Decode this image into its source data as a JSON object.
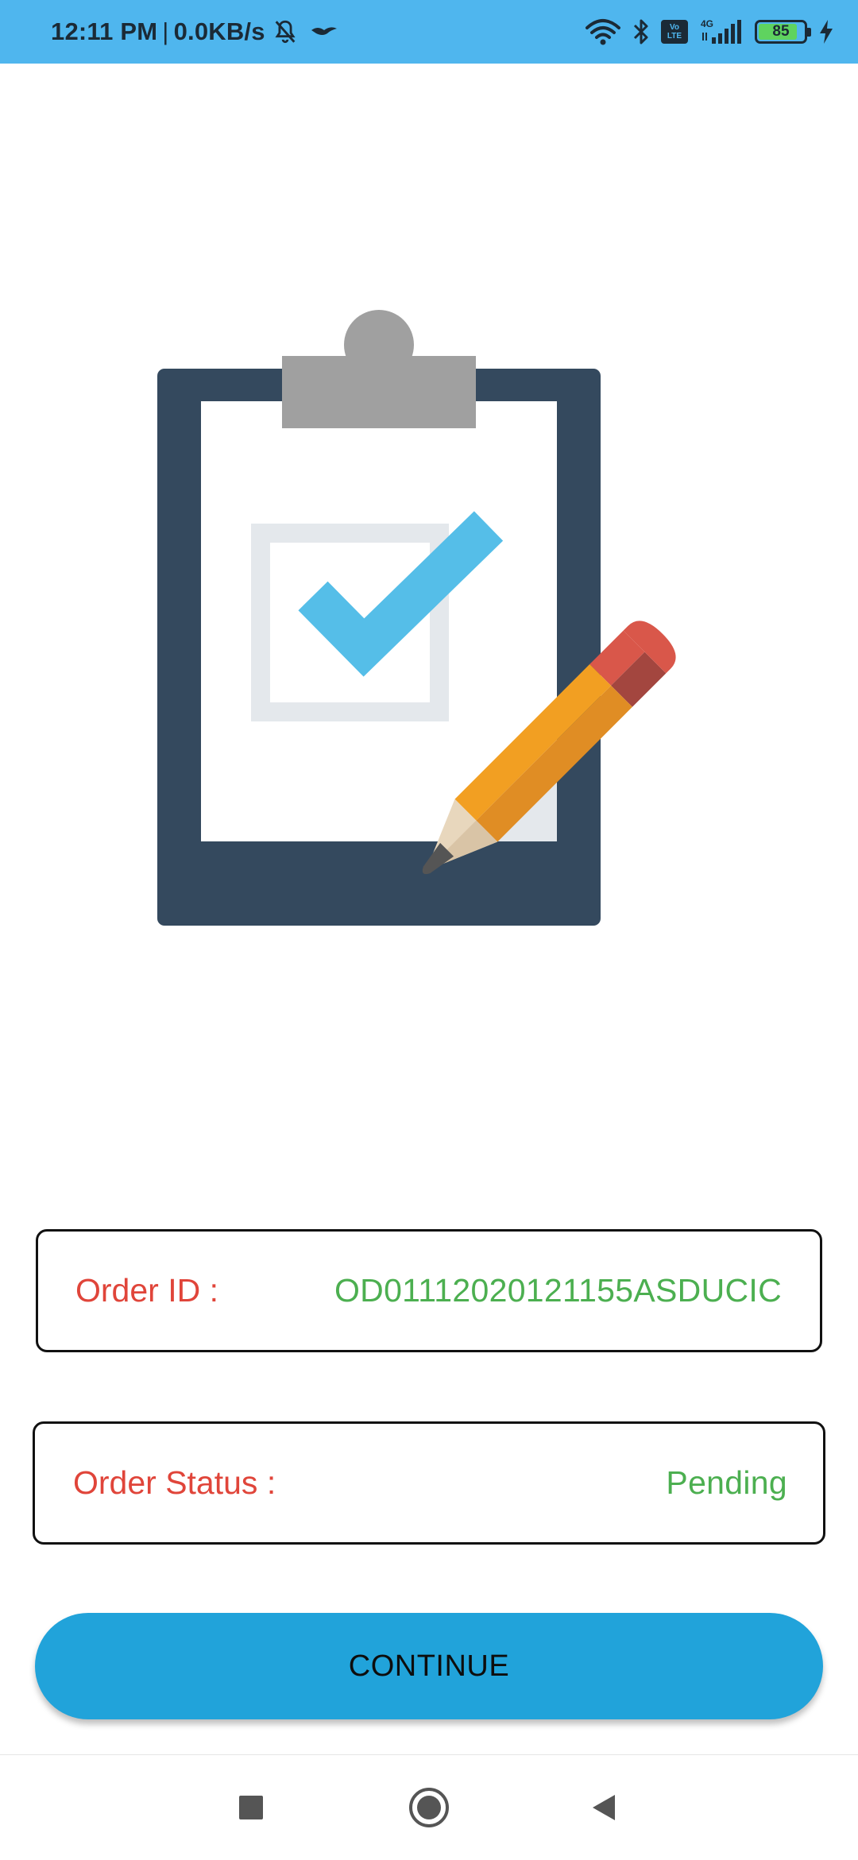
{
  "status_bar": {
    "time": "12:11 PM",
    "separator": "|",
    "network_speed": "0.0KB/s",
    "battery_level": "85",
    "battery_fraction": 0.85,
    "network_type": "4G",
    "volte_line1": "Vo",
    "volte_line2": "LTE",
    "icons": [
      "mute-icon",
      "bird-icon",
      "wifi-icon",
      "bluetooth-icon",
      "volte-icon",
      "signal-icon",
      "battery-icon",
      "charging-icon"
    ]
  },
  "order": {
    "id_label": "Order ID :",
    "id_value": "OD01112020121155ASDUCIC",
    "status_label": "Order Status :",
    "status_value": "Pending"
  },
  "actions": {
    "continue_label": "CONTINUE"
  },
  "nav_bar": {
    "icons": [
      "recents-icon",
      "home-icon",
      "back-icon"
    ]
  },
  "colors": {
    "status_bar": "#4fb6ee",
    "label": "#e0453a",
    "value": "#4caf50",
    "button": "#21a3da",
    "clipboard": "#34495e",
    "check": "#55bee8"
  }
}
